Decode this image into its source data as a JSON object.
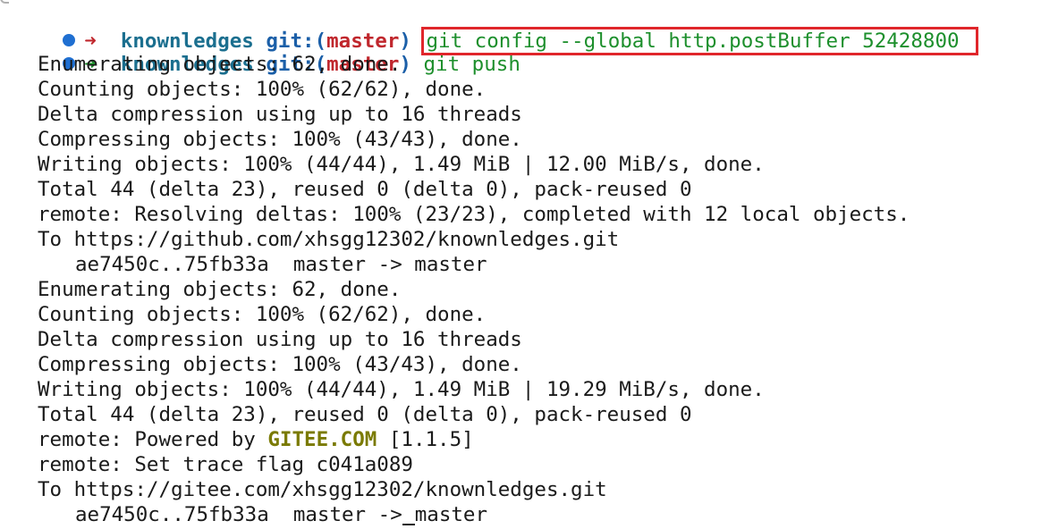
{
  "prompts": [
    {
      "arrow": "➜",
      "directory": "knownledges",
      "git_prefix": "git:(",
      "branch": "master",
      "git_suffix": ")",
      "command": "git config --global http.postBuffer 52428800"
    },
    {
      "arrow": "➜",
      "directory": "knownledges",
      "git_prefix": "git:(",
      "branch": "master",
      "git_suffix": ")",
      "command": "git push"
    }
  ],
  "output": {
    "l1": "Enumerating objects: 62, done.",
    "l2": "Counting objects: 100% (62/62), done.",
    "l3": "Delta compression using up to 16 threads",
    "l4": "Compressing objects: 100% (43/43), done.",
    "l5": "Writing objects: 100% (44/44), 1.49 MiB | 12.00 MiB/s, done.",
    "l6": "Total 44 (delta 23), reused 0 (delta 0), pack-reused 0",
    "l7": "remote: Resolving deltas: 100% (23/23), completed with 12 local objects.",
    "l8": "To https://github.com/xhsgg12302/knownledges.git",
    "l9": "ae7450c..75fb33a  master -> master",
    "l10": "Enumerating objects: 62, done.",
    "l11": "Counting objects: 100% (62/62), done.",
    "l12": "Delta compression using up to 16 threads",
    "l13": "Compressing objects: 100% (43/43), done.",
    "l14": "Writing objects: 100% (44/44), 1.49 MiB | 19.29 MiB/s, done.",
    "l15": "Total 44 (delta 23), reused 0 (delta 0), pack-reused 0",
    "l16_prefix": "remote: Powered by ",
    "l16_brand": "GITEE.COM",
    "l16_suffix": " [1.1.5]",
    "l17": "remote: Set trace flag c041a089",
    "l18": "To https://gitee.com/xhsgg12302/knownledges.git",
    "l19": "ae7450c..75fb33a  master ->",
    "l19_tail": "master"
  },
  "colors": {
    "prompt_dot": "#1f6fd1",
    "arrow_fail": "#c0272d",
    "arrow_ok": "#1d8f2c",
    "directory": "#1b6f8f",
    "branch": "#c0272d",
    "command": "#1d8f2c",
    "highlight_border": "#e0262b",
    "gitee_brand": "#7a7a00"
  },
  "icons": {
    "status_dot": "status-dot-icon",
    "arrow": "arrow-right-icon"
  }
}
